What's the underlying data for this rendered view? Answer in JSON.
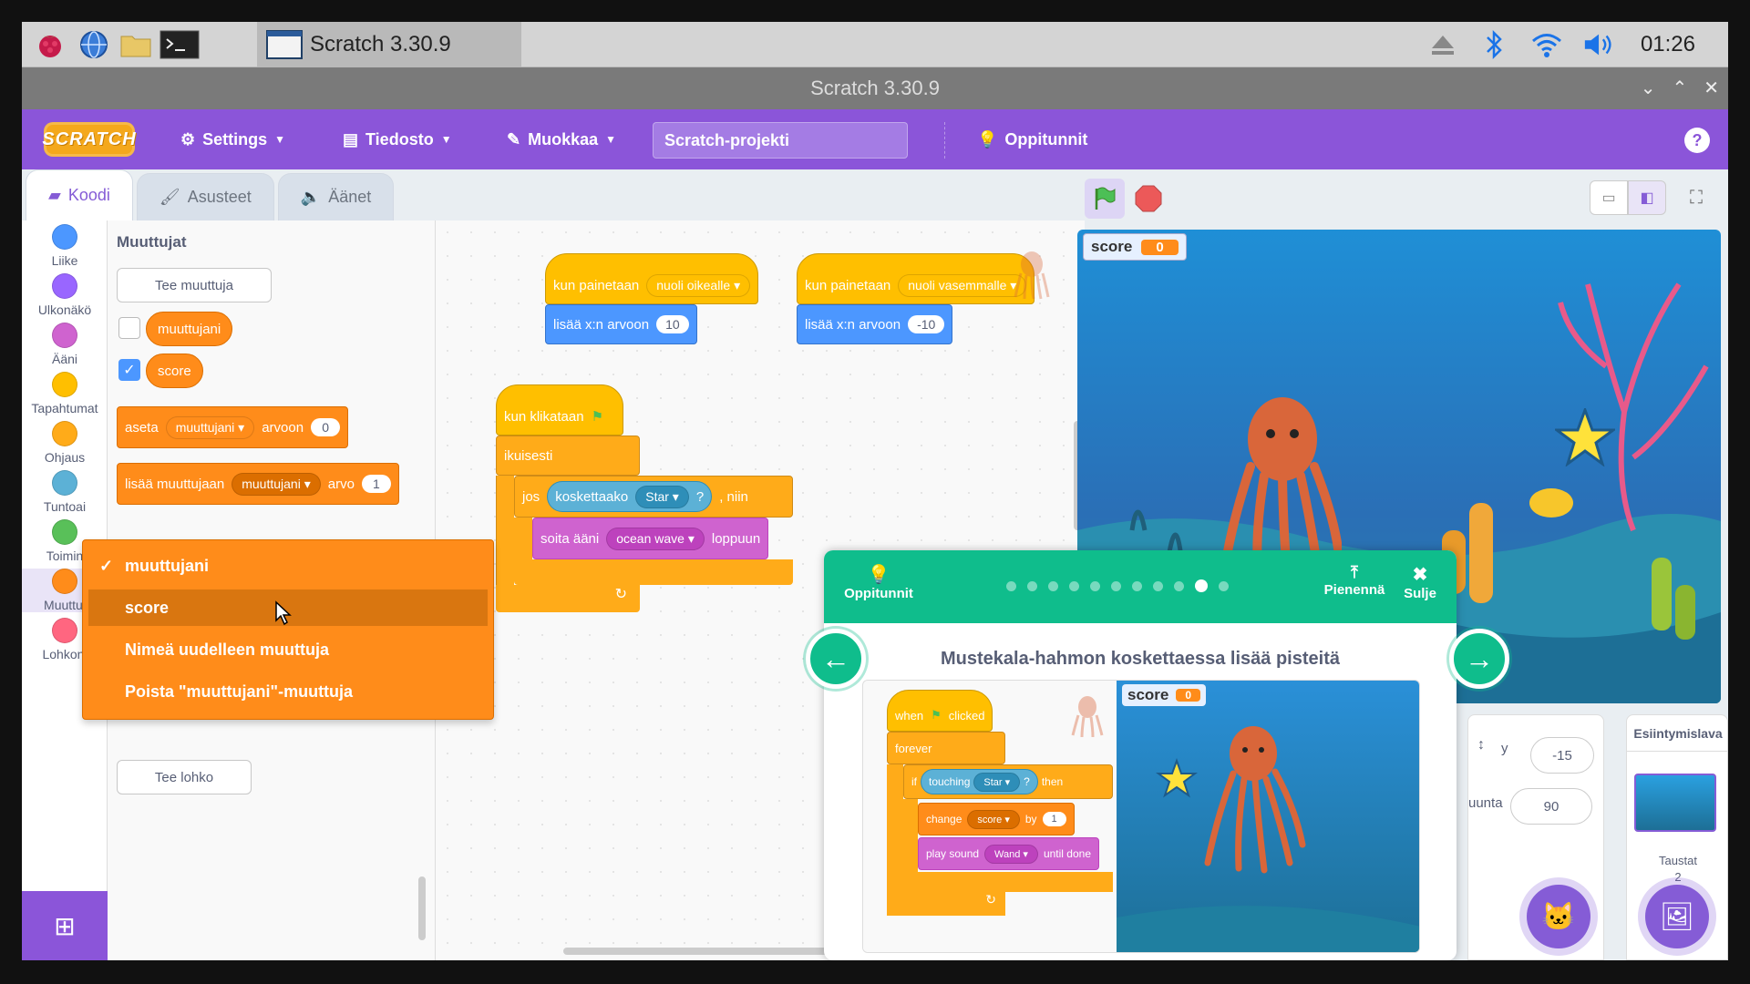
{
  "taskbar": {
    "active_window": "Scratch 3.30.9",
    "clock": "01:26"
  },
  "window": {
    "title": "Scratch 3.30.9"
  },
  "menubar": {
    "logo": "SCRATCH",
    "settings": "Settings",
    "file": "Tiedosto",
    "edit": "Muokkaa",
    "project_name": "Scratch-projekti",
    "tutorials": "Oppitunnit",
    "help": "?"
  },
  "tabs": {
    "code": "Koodi",
    "costumes": "Asusteet",
    "sounds": "Äänet"
  },
  "categories": [
    {
      "label": "Liike",
      "color": "#4c97ff"
    },
    {
      "label": "Ulkonäkö",
      "color": "#9966ff"
    },
    {
      "label": "Ääni",
      "color": "#cf63cf"
    },
    {
      "label": "Tapahtumat",
      "color": "#ffbf00"
    },
    {
      "label": "Ohjaus",
      "color": "#ffab19"
    },
    {
      "label": "Tuntoai",
      "color": "#5cb1d6"
    },
    {
      "label": "Toimin",
      "color": "#59c059"
    },
    {
      "label": "Muuttuj",
      "color": "#ff8c1a"
    },
    {
      "label": "Lohkoni",
      "color": "#ff6680"
    }
  ],
  "palette": {
    "heading": "Muuttujat",
    "make_variable": "Tee muuttuja",
    "var1": "muuttujani",
    "var2": "score",
    "set_block": {
      "label": "aseta",
      "var": "muuttujani",
      "to": "arvoon",
      "value": "0"
    },
    "change_block": {
      "label": "lisää muuttujaan",
      "var": "muuttujani",
      "by": "arvo",
      "value": "1"
    },
    "make_block": "Tee lohko"
  },
  "dropdown": {
    "items": [
      "muuttujani",
      "score",
      "Nimeä uudelleen muuttuja",
      "Poista \"muuttujani\"-muuttuja"
    ],
    "check": "✓"
  },
  "scripts": {
    "s1": {
      "hat": "kun painetaan",
      "key": "nuoli oikealle",
      "motion": "lisää x:n arvoon",
      "value": "10"
    },
    "s2": {
      "hat": "kun painetaan",
      "key": "nuoli vasemmalle",
      "motion": "lisää x:n arvoon",
      "value": "-10"
    },
    "s3": {
      "hat": "kun klikataan",
      "forever": "ikuisesti",
      "if": "jos",
      "touching": "koskettaako",
      "target": "Star",
      "q": "?",
      "then": ", niin",
      "sound": "soita ääni",
      "sound_name": "ocean wave",
      "until": "loppuun"
    }
  },
  "stage": {
    "monitor_label": "score",
    "monitor_value": "0"
  },
  "sprite_info": {
    "y_label": "y",
    "y_value": "-15",
    "dir_label": "uunta",
    "dir_value": "90"
  },
  "stage_pane": {
    "title": "Esiintymislava",
    "backdrops_label": "Taustat",
    "backdrops_count": "2"
  },
  "tutorial": {
    "tutorials": "Oppitunnit",
    "shrink": "Pienennä",
    "close": "Sulje",
    "title": "Mustekala-hahmon koskettaessa lisää pisteitä",
    "steps_total": 11,
    "step_current": 10,
    "preview": {
      "hat": "when",
      "hat2": "clicked",
      "forever": "forever",
      "if": "if",
      "touching": "touching",
      "star": "Star",
      "q": "?",
      "then": "then",
      "change": "change",
      "var": "score",
      "by": "by",
      "by_value": "1",
      "play": "play sound",
      "sound": "Wand",
      "until": "until done",
      "monitor_label": "score",
      "monitor_value": "0"
    }
  },
  "colors": {
    "accent": "#855cd6",
    "menubar": "#8b55d9",
    "tutorial": "#0fbd8c"
  }
}
